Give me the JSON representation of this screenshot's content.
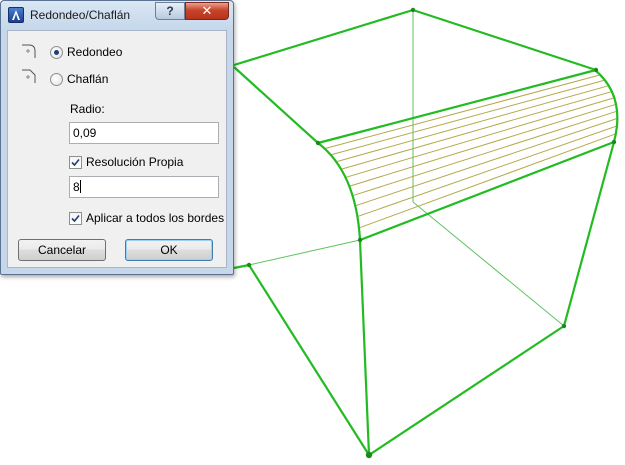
{
  "dialog": {
    "title": "Redondeo/Chaflán",
    "help_label": "?",
    "close_label": "✕",
    "app_icon": "archicad-app-icon",
    "colors": {
      "frame": "#c6d7ea",
      "close": "#c7452b",
      "client": "#f0f0f0"
    }
  },
  "mode": {
    "selected": "Redondeo",
    "options": [
      {
        "label": "Redondeo",
        "icon": "fillet-edge-icon",
        "checked": true
      },
      {
        "label": "Chaflán",
        "icon": "chamfer-edge-icon",
        "checked": false
      }
    ]
  },
  "radius": {
    "label": "Radio:",
    "value": "0,09"
  },
  "resolution": {
    "label": "Resolución Propia",
    "checked": true,
    "value": "8"
  },
  "apply_all": {
    "label": "Aplicar a todos los bordes",
    "checked": true
  },
  "buttons": {
    "cancel": "Cancelar",
    "ok": "OK"
  },
  "model": {
    "edge_color": "#22bb22",
    "segment_color": "#b5a94a",
    "vertex_color": "#1a8a1a"
  }
}
